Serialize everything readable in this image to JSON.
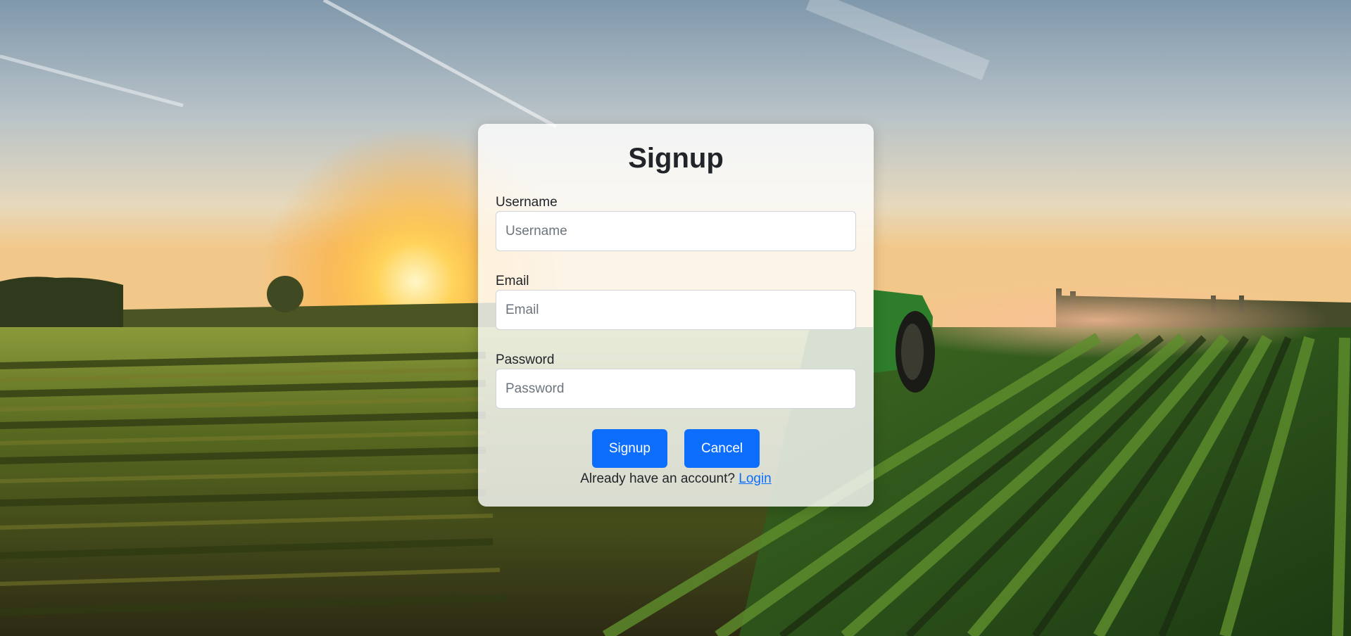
{
  "signup_form": {
    "title": "Signup",
    "username": {
      "label": "Username",
      "placeholder": "Username",
      "value": ""
    },
    "email": {
      "label": "Email",
      "placeholder": "Email",
      "value": ""
    },
    "password": {
      "label": "Password",
      "placeholder": "Password",
      "value": ""
    },
    "signup_button": "Signup",
    "cancel_button": "Cancel",
    "login_prompt": "Already have an account?",
    "login_link": "Login"
  },
  "colors": {
    "primary": "#0d6efd",
    "text": "#212529",
    "placeholder": "#6c757d",
    "card_background": "rgba(255,255,255,0.80)"
  },
  "background": {
    "icon": "farm-field-tractor-sunset-image"
  }
}
